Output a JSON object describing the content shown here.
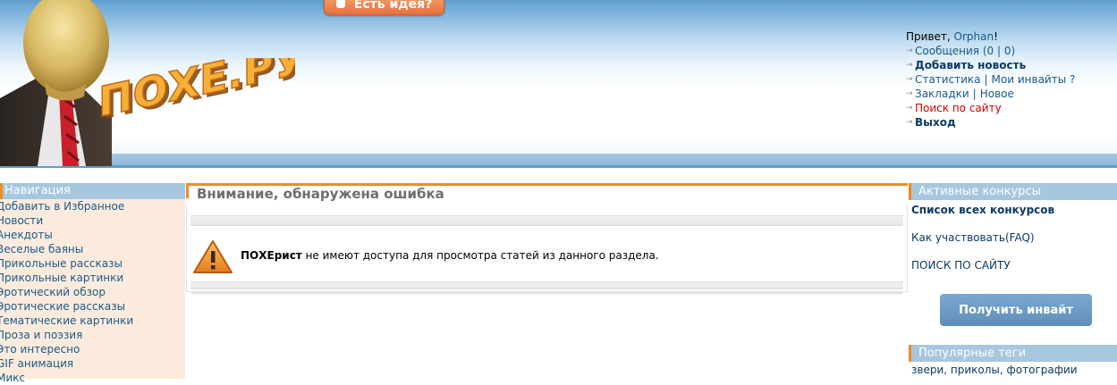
{
  "header": {
    "idea_button": "Есть идея?",
    "logo_text": "ПОХЕ.РУ"
  },
  "user_menu": {
    "greeting": "Привет,",
    "username": "Orphan",
    "greeting_end": "!",
    "messages": "Сообщения (0 | 0)",
    "add_news": "Добавить новость",
    "statistics": "Статистика",
    "my_invites": "Мои инвайты ?",
    "bookmarks": "Закладки",
    "new": "Новое",
    "site_search": "Поиск по сайту",
    "logout": "Выход"
  },
  "left_sidebar": {
    "title": "Навигация",
    "items": [
      "Добавить в Избранное",
      "Новости",
      "Анекдоты",
      "Веселые баяны",
      "Прикольные рассказы",
      "Прикольные картинки",
      "Эротический обзор",
      "Эротические рассказы",
      "Тематические картинки",
      "Проза и поэзия",
      "Это интересно",
      "GIF анимация",
      "Микс"
    ]
  },
  "main": {
    "title": "Внимание, обнаружена ошибка",
    "message_bold": "ПОХЕрист",
    "message_rest": " не имеют доступа для просмотра статей из данного раздела."
  },
  "right_sidebar": {
    "contests_title": "Активные конкурсы",
    "all_contests": "Список всех конкурсов",
    "how_to": "Как участвовать(FAQ)",
    "search": "ПОИСК ПО САЙТУ",
    "invite_button": "Получить инвайт",
    "tags_title": "Популярные теги",
    "tags": "звери, приколы, фотографии"
  },
  "colors": {
    "accent_orange": "#f08a24",
    "header_blue": "#a7c7df",
    "link": "#1a5a8a",
    "sidebar_bg": "#fcebdc"
  }
}
